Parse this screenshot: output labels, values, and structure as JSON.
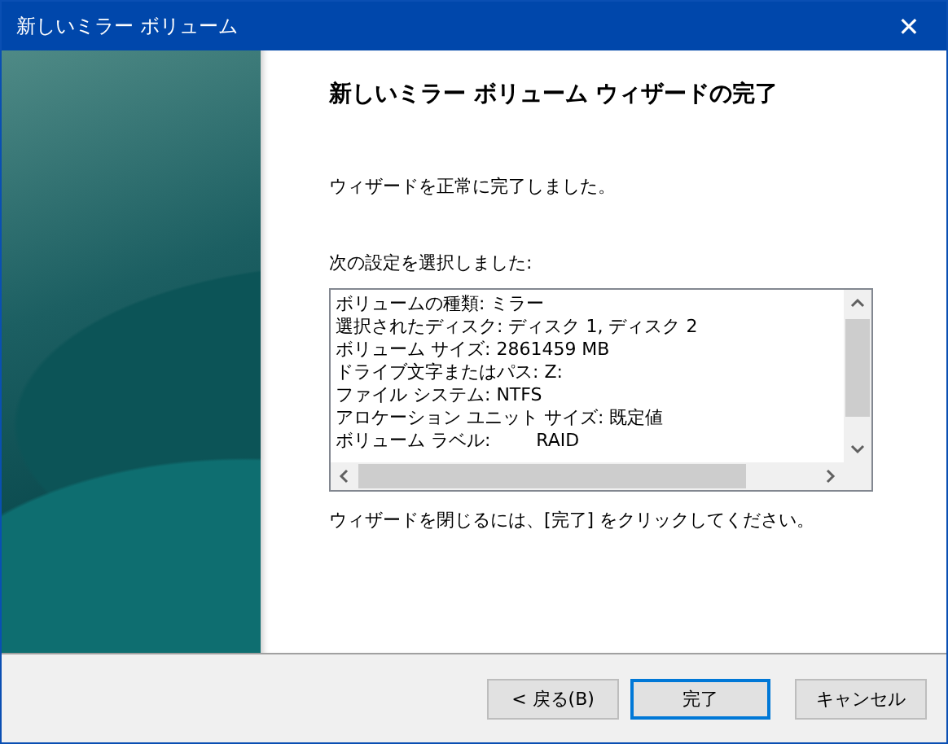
{
  "window": {
    "title": "新しいミラー ボリューム",
    "close": "✕"
  },
  "heading": "新しいミラー ボリューム ウィザードの完了",
  "message": "ウィザードを正常に完了しました。",
  "settings_label": "次の設定を選択しました:",
  "settings": [
    "ボリュームの種類: ミラー",
    "選択されたディスク: ディスク 1, ディスク 2",
    "ボリューム サイズ: 2861459 MB",
    "ドライブ文字またはパス: Z:",
    "ファイル システム: NTFS",
    "アロケーション ユニット サイズ: 既定値",
    "ボリューム ラベル:        RAID"
  ],
  "hint": "ウィザードを閉じるには、[完了] をクリックしてください。",
  "buttons": [
    {
      "label": "< 戻る(B)",
      "default": false
    },
    {
      "label": "完了",
      "default": true
    },
    {
      "label": "キャンセル",
      "default": false
    }
  ]
}
